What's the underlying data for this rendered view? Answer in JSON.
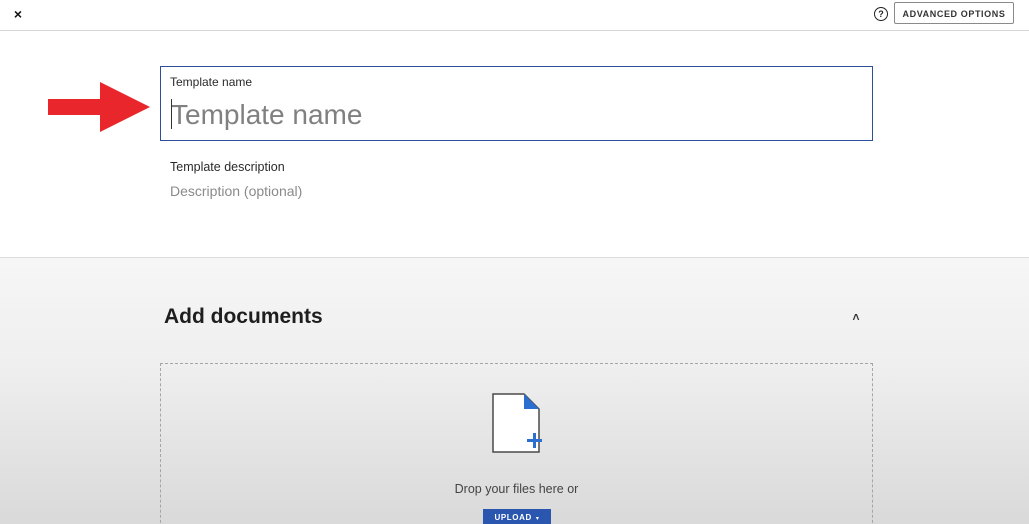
{
  "header": {
    "close_glyph": "×",
    "help_glyph": "?",
    "advanced_options_label": "ADVANCED OPTIONS"
  },
  "template": {
    "name_label": "Template name",
    "name_placeholder": "Template name",
    "description_label": "Template description",
    "description_placeholder": "Description (optional)"
  },
  "documents": {
    "title": "Add documents",
    "collapse_glyph": "˄",
    "drop_text": "Drop your files here or",
    "upload_label": "UPLOAD",
    "upload_caret": "▾"
  },
  "annotation": {
    "arrow_color": "#e8262b"
  },
  "colors": {
    "accent_blue": "#2b56b0",
    "focus_border": "#2d4f9a"
  },
  "icons": {
    "close": "close-icon",
    "help": "help-circle-icon",
    "collapse": "chevron-up-icon",
    "file_add": "file-add-icon",
    "upload_dropdown": "caret-down-icon",
    "arrow": "red-arrow-pointer"
  }
}
